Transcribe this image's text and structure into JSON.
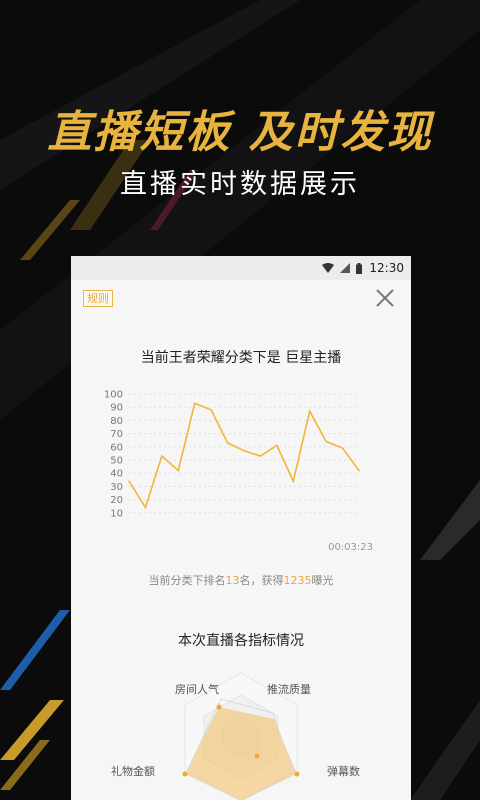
{
  "hero": {
    "headline": "直播短板  及时发现",
    "subline": "直播实时数据展示"
  },
  "status_bar": {
    "time": "12:30",
    "icons": [
      "wifi-icon",
      "signal-icon",
      "battery-icon"
    ]
  },
  "panel": {
    "rules_label": "规则",
    "close_icon": "close-icon",
    "chart_title": "当前王者荣耀分类下是 巨星主播",
    "timestamp": "00:03:23",
    "rank_prefix": "当前分类下排名",
    "rank_value": "13",
    "rank_mid": "名，获得",
    "exposure_value": "1235",
    "rank_suffix": "曝光",
    "radar_title": "本次直播各指标情况",
    "radar_labels": {
      "room_popularity": "房间人气",
      "stream_quality": "推流质量",
      "danmaku_count": "弹幕数",
      "gift_amount": "礼物金额"
    }
  },
  "colors": {
    "accent": "#e8b43e",
    "line": "#f3b536",
    "background": "#0b0b0c",
    "panel": "#f6f6f6"
  },
  "chart_data": {
    "type": "line",
    "title": "当前王者荣耀分类下是 巨星主播",
    "xlabel": "",
    "ylabel": "",
    "ylim": [
      0,
      100
    ],
    "yticks": [
      10,
      20,
      30,
      40,
      50,
      60,
      70,
      80,
      90,
      100
    ],
    "grid": true,
    "series": [
      {
        "values": [
          34,
          14,
          53,
          42,
          93,
          88,
          63,
          57,
          53,
          61,
          34,
          87,
          64,
          59,
          42
        ]
      }
    ]
  }
}
